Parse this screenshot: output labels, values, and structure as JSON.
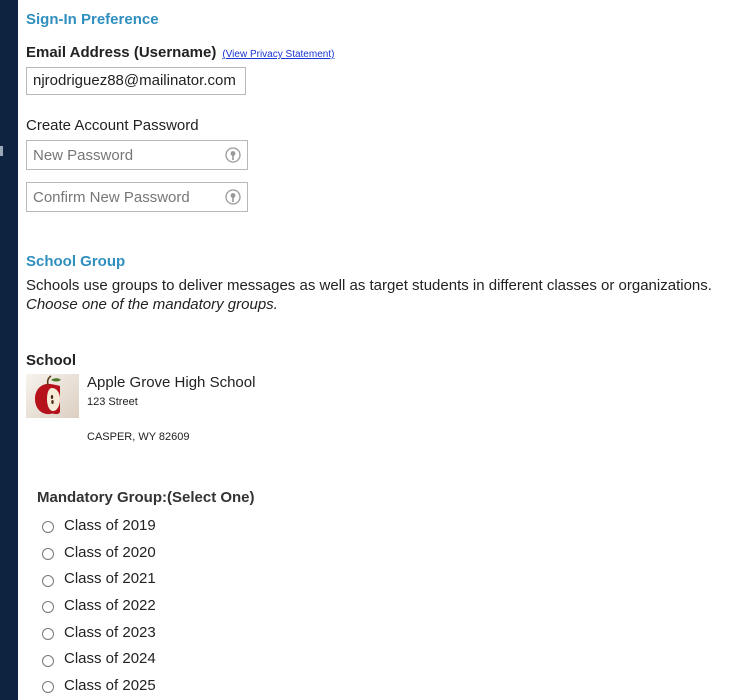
{
  "signin": {
    "section_title": "Sign-In Preference",
    "email_label": "Email Address (Username)",
    "privacy_link": "(View Privacy Statement)",
    "email_value": "njrodriguez88@mailinator.com",
    "password_label": "Create Account Password",
    "new_password_placeholder": "New Password",
    "confirm_password_placeholder": "Confirm New Password"
  },
  "school_group": {
    "section_title": "School Group",
    "description": "Schools use groups to deliver messages as well as target students in different classes or organizations.",
    "instruction": "Choose one of the mandatory groups."
  },
  "school": {
    "label": "School",
    "logo_icon": "apple-logo-icon",
    "name": "Apple Grove High School",
    "street": "123 Street",
    "city_state_zip": "CASPER, WY 82609"
  },
  "mandatory_group": {
    "title": "Mandatory Group:(Select One)",
    "options": [
      {
        "label": "Class of 2019"
      },
      {
        "label": "Class of 2020"
      },
      {
        "label": "Class of 2021"
      },
      {
        "label": "Class of 2022"
      },
      {
        "label": "Class of 2023"
      },
      {
        "label": "Class of 2024"
      },
      {
        "label": "Class of 2025"
      }
    ]
  },
  "colors": {
    "frame_background": "#0d2340",
    "section_title": "#2f8fbf",
    "link": "#1a35d6"
  }
}
